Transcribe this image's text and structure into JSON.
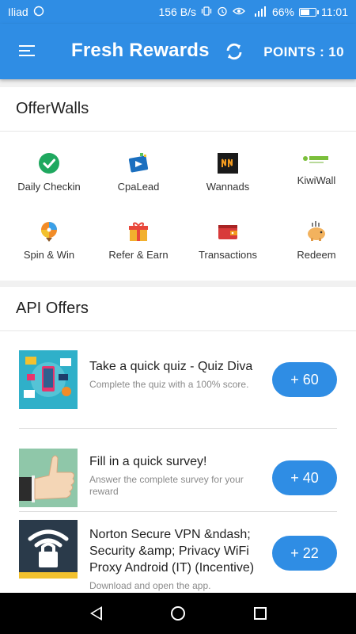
{
  "status_bar": {
    "carrier": "Iliad",
    "net_speed": "156 B/s",
    "battery": "66%",
    "battery_level": 0.66,
    "time": "11:01"
  },
  "app_bar": {
    "title": "Fresh Rewards",
    "points": "POINTS : 10"
  },
  "offerwalls": {
    "header": "OfferWalls",
    "items": [
      {
        "label": "Daily Checkin"
      },
      {
        "label": "CpaLead"
      },
      {
        "label": "Wannads"
      },
      {
        "label": "KiwiWall"
      },
      {
        "label": "Spin & Win"
      },
      {
        "label": "Refer & Earn"
      },
      {
        "label": "Transactions"
      },
      {
        "label": "Redeem"
      }
    ]
  },
  "api_offers": {
    "header": "API Offers",
    "offers": [
      {
        "title": "Take a quick quiz - Quiz Diva",
        "description": "Complete the quiz with a 100% score.",
        "points": "+ 60"
      },
      {
        "title": "Fill in a quick survey!",
        "description": "Answer the complete survey for your reward",
        "points": "+ 40"
      },
      {
        "title": "Norton Secure VPN &ndash; Security &amp; Privacy WiFi Proxy Android (IT) (Incentive)",
        "description": "Download and open the app.",
        "points": "+ 22"
      }
    ]
  },
  "colors": {
    "primary": "#2f8de4",
    "background": "#f1f1f1"
  }
}
